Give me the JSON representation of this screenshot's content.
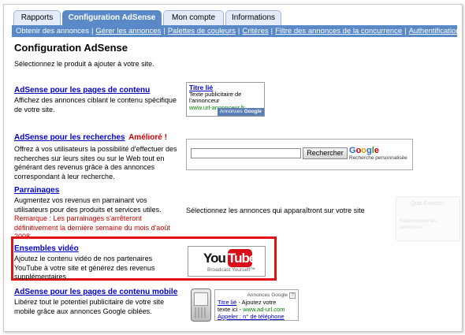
{
  "tabs": [
    "Rapports",
    "Configuration AdSense",
    "Mon compte",
    "Informations"
  ],
  "subnav": {
    "current": "Obtenir des annonces",
    "links": [
      "Gérer les annonces",
      "Palettes de couleurs",
      "Critères",
      "Filtre des annonces de la concurrence",
      "Authentification du site"
    ]
  },
  "page": {
    "title": "Configuration AdSense",
    "intro": "Sélectionnez le produit à ajouter à votre site."
  },
  "sections": {
    "content": {
      "title": "AdSense pour les pages de contenu",
      "desc": "Affichez des annonces ciblant le contenu spécifique de votre site."
    },
    "search": {
      "title": "AdSense pour les recherches",
      "badge": "Amélioré !",
      "desc": "Offrez à vos utilisateurs la possibilité d'effectuer des recherches sur leurs sites ou sur le Web tout en générant des revenus grâce à des annonces correspondant à leur recherche."
    },
    "referrals": {
      "title": "Parrainages",
      "desc": "Augmentez vos revenus en parrainant vos utilisateurs pour des produits et services utiles.",
      "note": "Remarque : Les parrainages s'arrêteront définitivement la dernière semaine du mois d'août 2008.",
      "right_text": "Sélectionnez les annonces qui apparaîtront sur votre site"
    },
    "video": {
      "title": "Ensembles vidéo",
      "desc": "Ajoutez le contenu vidéo de nos partenaires YouTube à votre site et générez des revenus supplémentaires."
    },
    "mobile": {
      "title": "AdSense pour les pages de contenu mobile",
      "desc": "Libérez tout le potentiel publicitaire de votre site mobile grâce aux annonces Google ciblées."
    }
  },
  "sample_ad": {
    "title": "Titre lié",
    "line1": "Texte publicitaire de",
    "line2": "l'annonceur",
    "url": "www.url-annonceur.fr",
    "badge_prefix": "Annonces",
    "badge_brand": "Google"
  },
  "search_sample": {
    "button": "Rechercher",
    "subtitle": "Recherche personnalisée"
  },
  "ghost_widget": {
    "title": "Quiz Explorer",
    "text": "Sélectionnez les annonces"
  },
  "youtube": {
    "you": "You",
    "tube": "Tube",
    "tagline": "Broadcast Yourself™"
  },
  "mobile_ad": {
    "header": "Annonces Google",
    "help": "?",
    "title": "Titre lié",
    "text_a": "- Ajoutez votre",
    "text_b": "texte ici -",
    "url": "www.ad-url.com",
    "phone_link": "Appeler : n° de téléphone"
  },
  "colors": {
    "tab_active": "#5a89c7",
    "tab_inactive": "#e5ecf9",
    "link": "#0000cc",
    "alert": "#cc0000",
    "highlight_box": "#e21010",
    "youtube_red": "#d80f18"
  }
}
